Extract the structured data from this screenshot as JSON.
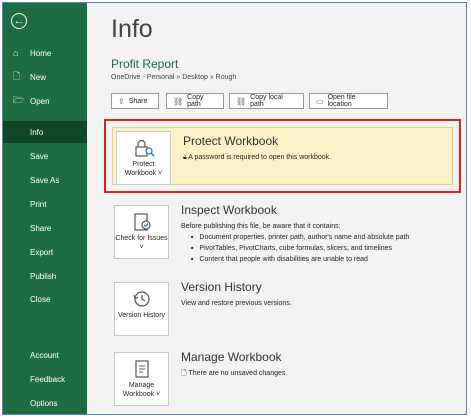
{
  "sidebar": {
    "back_icon": "back-arrow-icon",
    "items": [
      {
        "label": "Home",
        "icon": "home-icon"
      },
      {
        "label": "New",
        "icon": "new-file-icon"
      },
      {
        "label": "Open",
        "icon": "folder-open-icon"
      },
      {
        "label": "Info"
      },
      {
        "label": "Save"
      },
      {
        "label": "Save As"
      },
      {
        "label": "Print"
      },
      {
        "label": "Share"
      },
      {
        "label": "Export"
      },
      {
        "label": "Publish"
      },
      {
        "label": "Close"
      },
      {
        "label": "Account"
      },
      {
        "label": "Feedback"
      },
      {
        "label": "Options"
      }
    ],
    "active_item": "Info"
  },
  "main": {
    "title": "Info",
    "file_name": "Profit Report",
    "file_path": "OneDrive - Personal » Desktop » Rough",
    "toolbar": [
      "Share",
      "Copy path",
      "Copy local path",
      "Open file location"
    ]
  },
  "sections": {
    "protect": {
      "button_label": "Protect Workbook",
      "title": "Protect Workbook",
      "desc": "A password is required to open this workbook."
    },
    "inspect": {
      "button_label": "Check for Issues",
      "title": "Inspect Workbook",
      "desc": "Before publishing this file, be aware that it contains:",
      "bullets": [
        "Document properties, printer path, author's name and absolute path",
        "PivotTables, PivotCharts, cube formulas, slicers, and timelines",
        "Content that people with disabilities are unable to read"
      ]
    },
    "version": {
      "button_label": "Version History",
      "title": "Version History",
      "desc": "View and restore previous versions."
    },
    "manage": {
      "button_label": "Manage Workbook",
      "title": "Manage Workbook",
      "desc": "There are no unsaved changes."
    }
  },
  "colors": {
    "sidebar_bg": "#1e6c41",
    "sidebar_active": "#0f4727",
    "highlight_border": "#e02020",
    "protect_bg": "#fdf1c7"
  }
}
